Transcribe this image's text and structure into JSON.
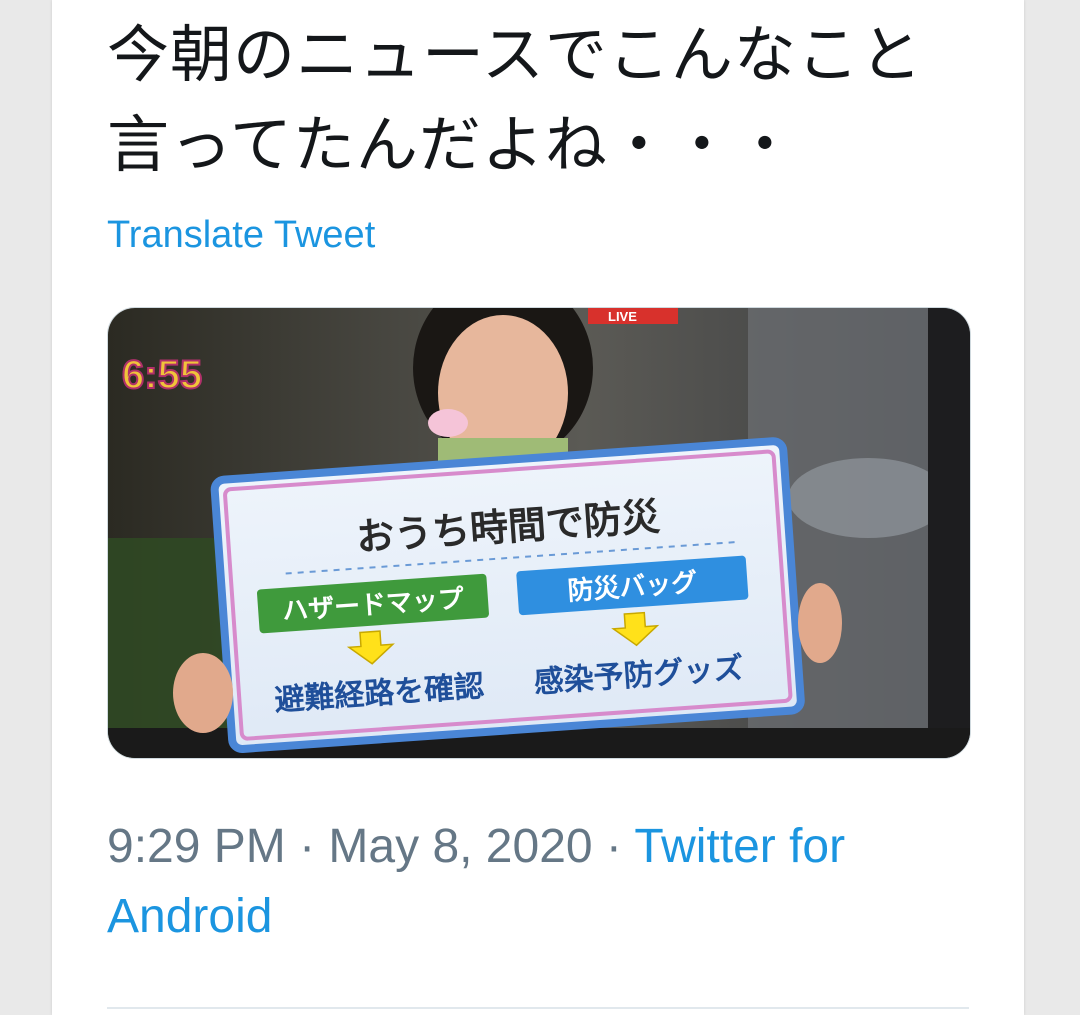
{
  "tweet": {
    "text": "今朝のニュースでこんなこと言ってたんだよね・・・",
    "translate_label": "Translate Tweet",
    "time": "9:29 PM",
    "separator": " · ",
    "date": "May 8, 2020",
    "source": "Twitter for Android"
  },
  "media": {
    "clock": "6:55",
    "live_badge": "LIVE",
    "board": {
      "title": "おうち時間で防災",
      "left_label": "ハザードマップ",
      "right_label": "防災バッグ",
      "left_result": "避難経路を確認",
      "right_result": "感染予防グッズ"
    }
  },
  "colors": {
    "link": "#1b95e0",
    "meta": "#657786",
    "text": "#14171a",
    "board_green": "#3f9a3c",
    "board_blue": "#2f8fe0",
    "arrow_yellow": "#ffe11a"
  }
}
